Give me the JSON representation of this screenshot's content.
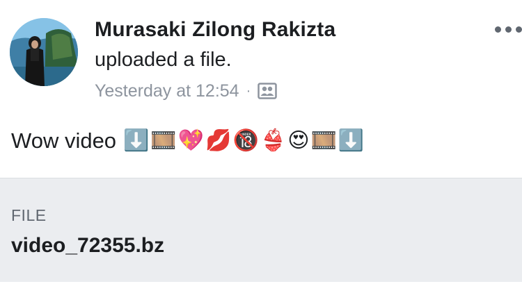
{
  "post": {
    "author_name": "Murasaki Zilong Rakizta",
    "action_text": "uploaded a file.",
    "timestamp": "Yesterday at 12:54",
    "separator": "·",
    "audience_icon": "friends-icon",
    "more_icon": "more-options-icon",
    "message": {
      "text": "Wow video",
      "emojis": [
        "⬇️",
        "🎞️",
        "💖",
        "💋",
        "🔞",
        "👙",
        "😍",
        "🎞️",
        "⬇️"
      ]
    },
    "attachment": {
      "label": "FILE",
      "file_name": "video_72355.bz"
    }
  },
  "colors": {
    "text_primary": "#1c1e21",
    "text_secondary": "#8d949e",
    "attachment_bg": "#ebedf0"
  }
}
